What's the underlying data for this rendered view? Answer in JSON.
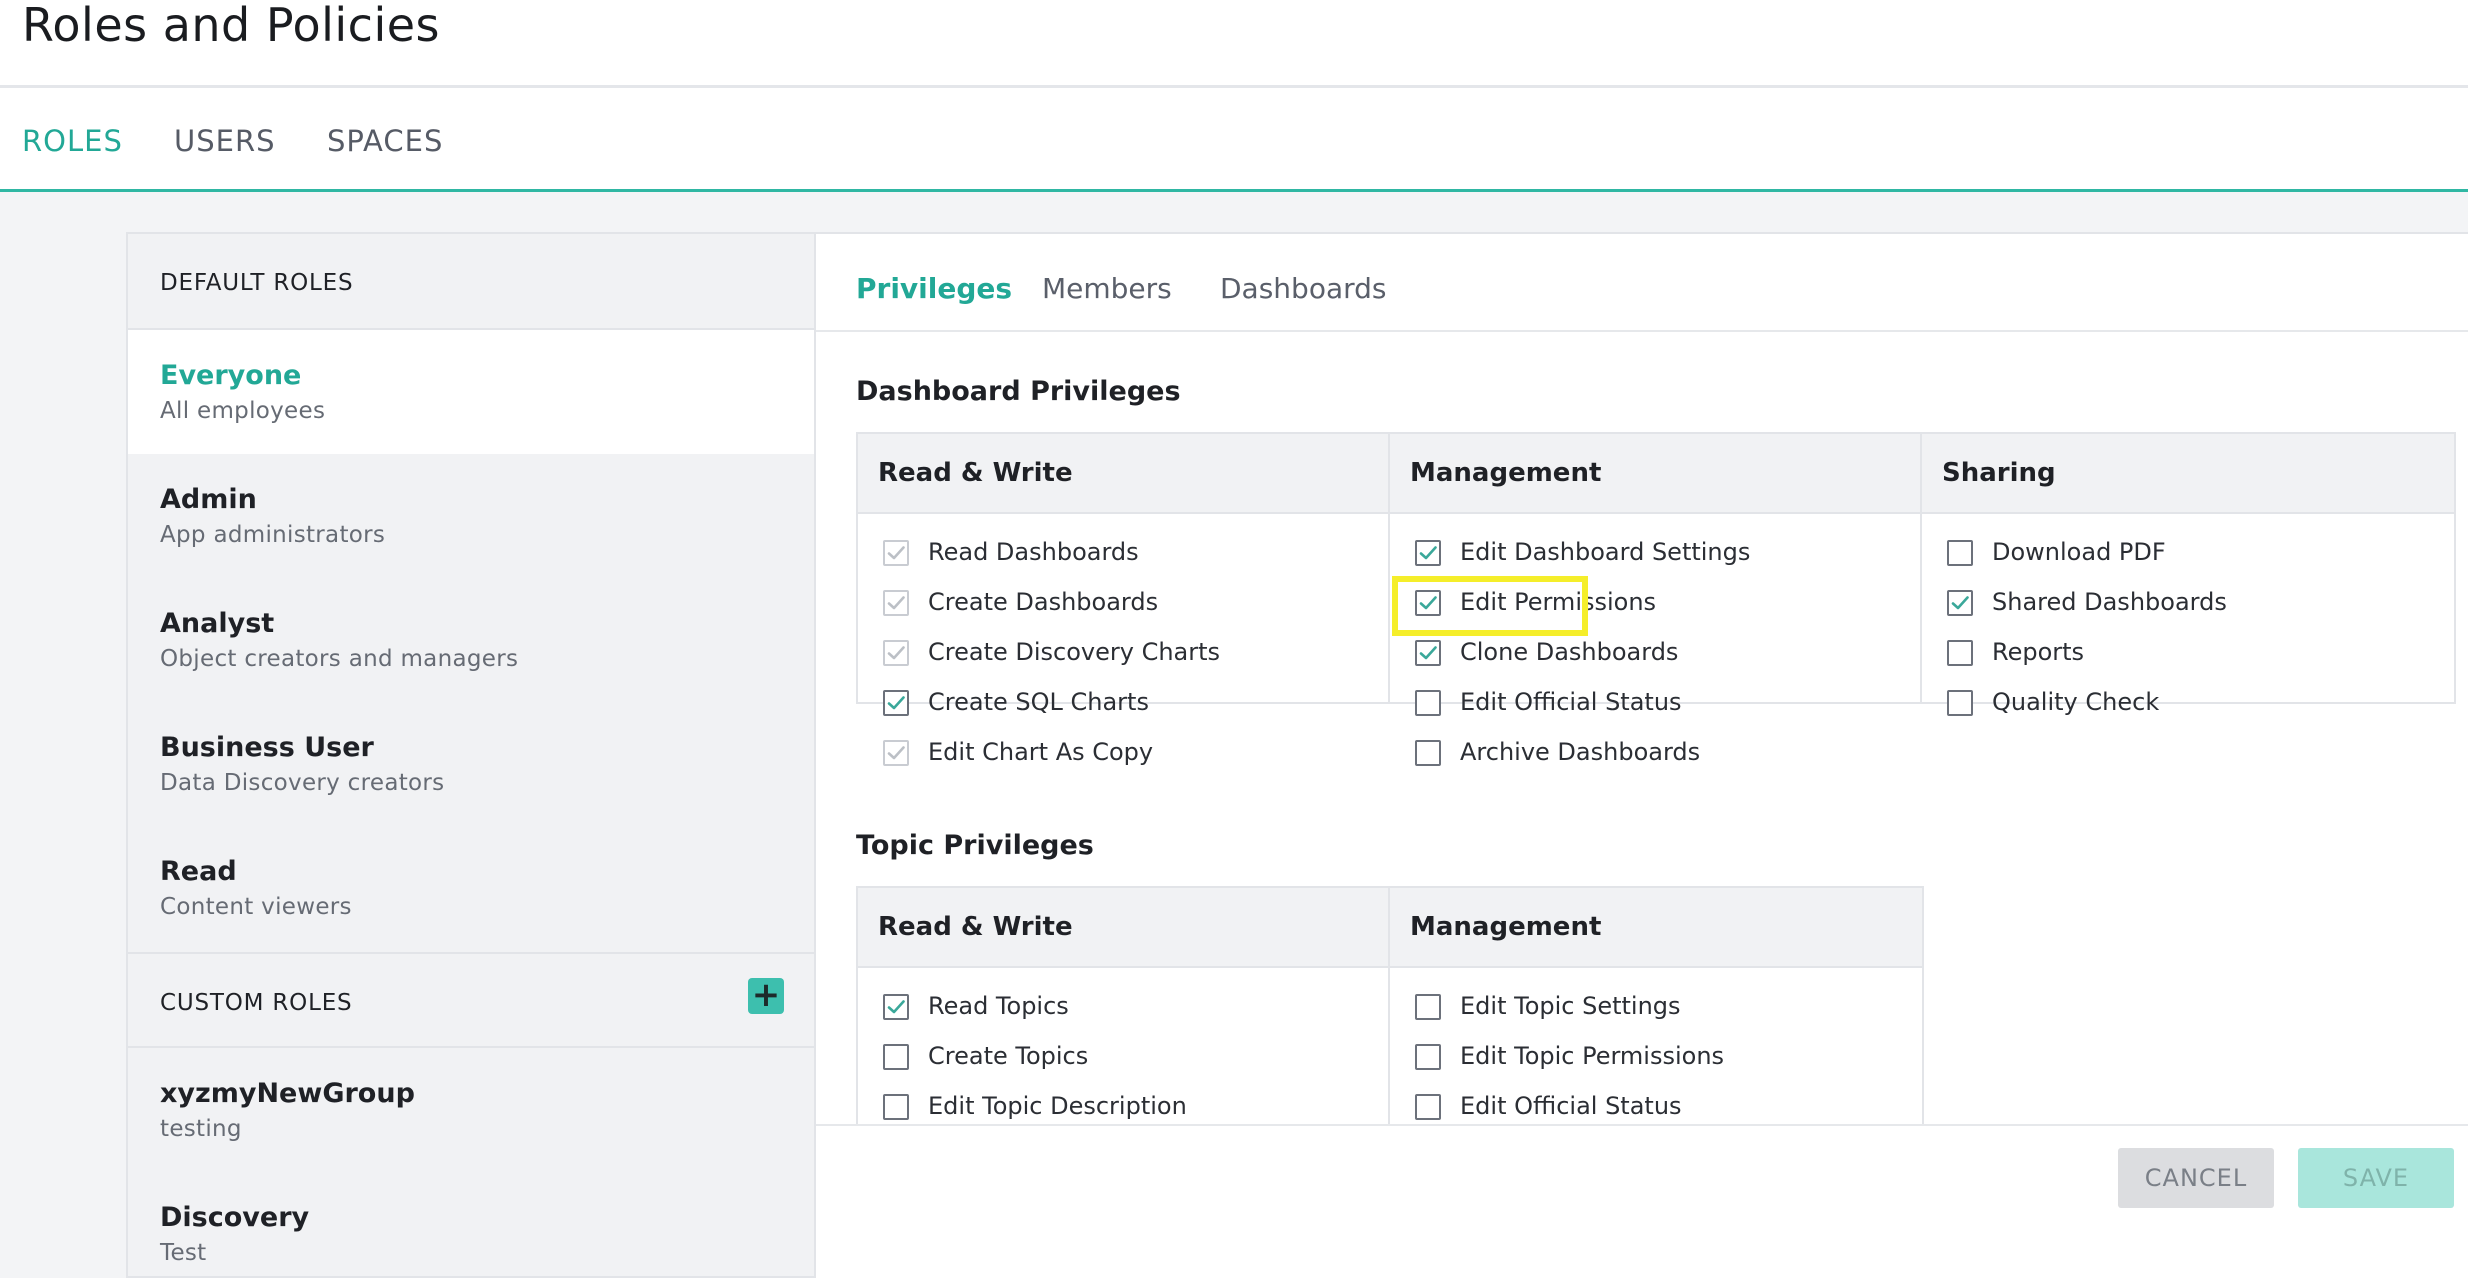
{
  "page": {
    "title": "Roles and Policies"
  },
  "top_nav": {
    "tabs": [
      {
        "label": "ROLES",
        "active": true
      },
      {
        "label": "USERS",
        "active": false
      },
      {
        "label": "SPACES",
        "active": false
      }
    ]
  },
  "roles_panel": {
    "default_header": "DEFAULT ROLES",
    "default_roles": [
      {
        "name": "Everyone",
        "desc": "All employees",
        "selected": true
      },
      {
        "name": "Admin",
        "desc": "App administrators",
        "selected": false
      },
      {
        "name": "Analyst",
        "desc": "Object creators and managers",
        "selected": false
      },
      {
        "name": "Business User",
        "desc": "Data Discovery creators",
        "selected": false
      },
      {
        "name": "Read",
        "desc": "Content viewers",
        "selected": false
      }
    ],
    "custom_header": "CUSTOM ROLES",
    "add_symbol": "+",
    "custom_roles": [
      {
        "name": "xyzmyNewGroup",
        "desc": "testing"
      },
      {
        "name": "Discovery",
        "desc": "Test"
      }
    ]
  },
  "detail": {
    "tabs": [
      {
        "label": "Privileges",
        "active": true
      },
      {
        "label": "Members",
        "active": false
      },
      {
        "label": "Dashboards",
        "active": false
      }
    ],
    "dashboard_section": {
      "title": "Dashboard Privileges",
      "columns": [
        {
          "header": "Read & Write",
          "items": [
            {
              "label": "Read Dashboards",
              "state": "checked-disabled"
            },
            {
              "label": "Create Dashboards",
              "state": "checked-disabled"
            },
            {
              "label": "Create Discovery Charts",
              "state": "checked-disabled"
            },
            {
              "label": "Create SQL Charts",
              "state": "checked"
            },
            {
              "label": "Edit Chart As Copy",
              "state": "checked-disabled"
            }
          ]
        },
        {
          "header": "Management",
          "items": [
            {
              "label": "Edit Dashboard Settings",
              "state": "checked"
            },
            {
              "label": "Edit Permissions",
              "state": "checked"
            },
            {
              "label": "Clone Dashboards",
              "state": "checked"
            },
            {
              "label": "Edit Official Status",
              "state": "unchecked"
            },
            {
              "label": "Archive Dashboards",
              "state": "unchecked"
            }
          ]
        },
        {
          "header": "Sharing",
          "items": [
            {
              "label": "Download PDF",
              "state": "unchecked"
            },
            {
              "label": "Shared Dashboards",
              "state": "checked"
            },
            {
              "label": "Reports",
              "state": "unchecked"
            },
            {
              "label": "Quality Check",
              "state": "unchecked"
            }
          ]
        }
      ]
    },
    "topic_section": {
      "title": "Topic Privileges",
      "columns": [
        {
          "header": "Read & Write",
          "items": [
            {
              "label": "Read Topics",
              "state": "checked"
            },
            {
              "label": "Create Topics",
              "state": "unchecked"
            },
            {
              "label": "Edit Topic Description",
              "state": "unchecked"
            }
          ]
        },
        {
          "header": "Management",
          "items": [
            {
              "label": "Edit Topic Settings",
              "state": "unchecked"
            },
            {
              "label": "Edit Topic Permissions",
              "state": "unchecked"
            },
            {
              "label": "Edit Official Status",
              "state": "unchecked"
            }
          ]
        }
      ]
    }
  },
  "footer": {
    "cancel_label": "CANCEL",
    "save_label": "SAVE"
  },
  "colors": {
    "accent": "#22a896",
    "highlight": "#f5ee2a",
    "check_enabled": "#3aa89a",
    "check_disabled": "#bcc0c6"
  }
}
